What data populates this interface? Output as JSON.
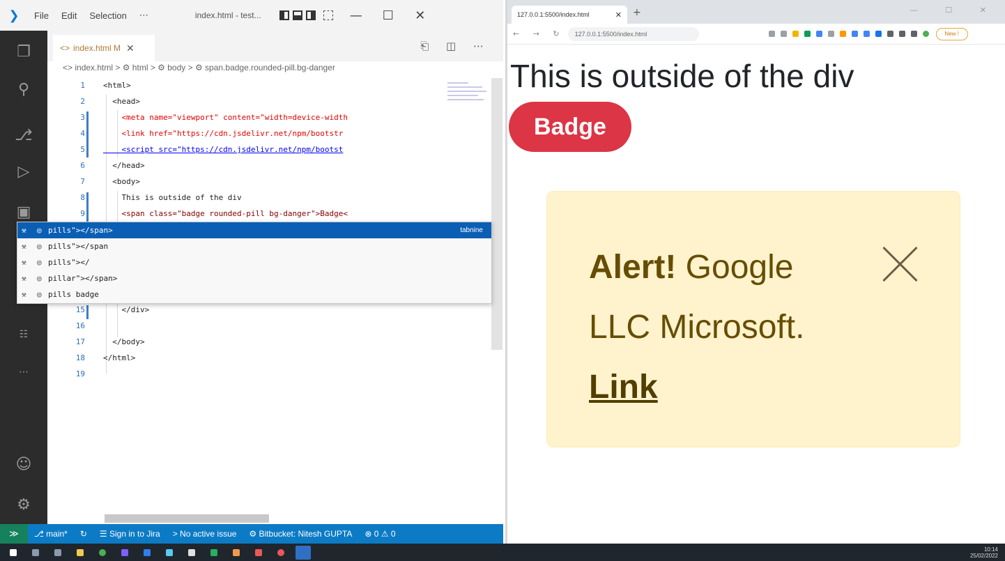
{
  "vscode": {
    "menu": [
      "File",
      "Edit",
      "Selection",
      "⋯"
    ],
    "window_title": "index.html - test...",
    "window_controls": [
      "—",
      "☐",
      "✕"
    ],
    "tab": {
      "label": "index.html M",
      "close": "✕"
    },
    "tab_actions": "⎗ ◫ ⋯",
    "breadcrumb": "<> index.html > ⚙ html > ⚙ body > ⚙ span.badge.rounded-pill.bg-danger",
    "gutter": [
      "1",
      "2",
      "3",
      "4",
      "5",
      "6",
      "7",
      "8",
      "9",
      "15",
      "16",
      "17",
      "18",
      "19"
    ],
    "code": [
      "<html>",
      "  <head>",
      "    <meta name=\"viewport\" content=\"width=device-width",
      "    <link href=\"https://cdn.jsdelivr.net/npm/bootstr",
      "    <script src=\"https://cdn.jsdelivr.net/npm/bootst",
      "  </head>",
      "  <body>",
      "    This is outside of the div",
      "    <span class=\"badge rounded-pill bg-danger\">Badge<",
      "    </div>",
      "",
      "  </body>",
      "</html>",
      ""
    ],
    "suggestions": [
      {
        "text": "pills\"></span>",
        "detail": "tabnine",
        "selected": true
      },
      {
        "text": "pills\"></span",
        "detail": "",
        "selected": false
      },
      {
        "text": "pills\"></",
        "detail": "",
        "selected": false
      },
      {
        "text": "pillar\"></span>",
        "detail": "",
        "selected": false
      },
      {
        "text": "pills badge",
        "detail": "",
        "selected": false
      }
    ],
    "status": {
      "remote": "≫",
      "branch": "⎇ main*",
      "sync": "↻",
      "signin": "☰ Sign in to Jira",
      "issue": "> No active issue",
      "bitbucket": "⚙ Bitbucket: Nitesh GUPTA",
      "problems": "⊗ 0 ⚠ 0"
    }
  },
  "browser": {
    "tab_title": "127.0.0.1:5500/index.html",
    "tab_close": "✕",
    "new_tab": "+",
    "window_controls": "— ☐ ✕",
    "nav": "← → ↻",
    "url": "127.0.0.1:5500/index.html",
    "profile": "New !",
    "page": {
      "outside_text": "This is outside of the div",
      "badge": "Badge",
      "alert_strong": "Alert!",
      "alert_text": " Google LLC Microsoft. ",
      "alert_link": "Link"
    }
  },
  "taskbar": {
    "clock_time": "10:14",
    "clock_date": "25/02/2022"
  },
  "colors": {
    "vscode_status": "#0c7bc5",
    "suggest_selected": "#0a5fb4",
    "badge_danger": "#dc3545",
    "alert_bg": "#fff3cd",
    "alert_text": "#664d03"
  }
}
